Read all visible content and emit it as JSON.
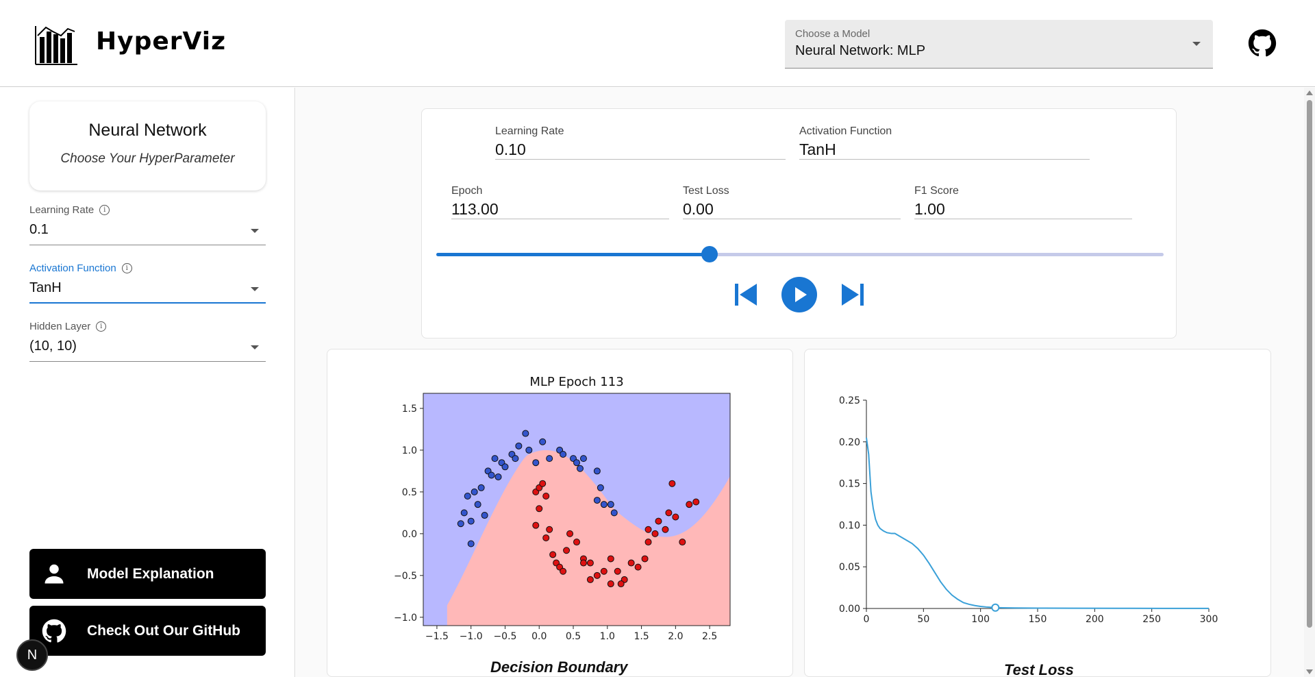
{
  "header": {
    "brand": "HyperViz",
    "model_select": {
      "label": "Choose a Model",
      "value": "Neural Network: MLP"
    }
  },
  "sidebar": {
    "card_title": "Neural Network",
    "card_subtitle": "Choose Your HyperParameter",
    "fields": [
      {
        "label": "Learning Rate",
        "value": "0.1"
      },
      {
        "label": "Activation Function",
        "value": "TanH"
      },
      {
        "label": "Hidden Layer",
        "value": "(10, 10)"
      }
    ],
    "buttons": {
      "explanation": "Model Explanation",
      "github": "Check Out Our GitHub"
    },
    "badge": "N"
  },
  "stats": {
    "learning_rate": {
      "label": "Learning Rate",
      "value": "0.10"
    },
    "activation": {
      "label": "Activation Function",
      "value": "TanH"
    },
    "epoch": {
      "label": "Epoch",
      "value": "113.00"
    },
    "test_loss": {
      "label": "Test Loss",
      "value": "0.00"
    },
    "f1": {
      "label": "F1 Score",
      "value": "1.00"
    }
  },
  "slider": {
    "value": 113,
    "max": 300,
    "fraction": 0.376
  },
  "colors": {
    "accent": "#1976d2",
    "blue_region": "#b8b8ff",
    "red_region": "#ffb8b8",
    "loss_line": "#3aa0d8"
  },
  "captions": {
    "boundary": "Decision Boundary",
    "loss": "Test Loss"
  },
  "chart_data": [
    {
      "type": "scatter",
      "title": "MLP Epoch 113",
      "xlim": [
        -1.7,
        2.8
      ],
      "ylim": [
        -1.1,
        1.68
      ],
      "xticks": [
        "−1.5",
        "−1.0",
        "−0.5",
        "0.0",
        "0.5",
        "1.0",
        "1.5",
        "2.0",
        "2.5"
      ],
      "yticks": [
        "−1.0",
        "−0.5",
        "0.0",
        "0.5",
        "1.0",
        "1.5"
      ],
      "series": [
        {
          "color": "#3355cc",
          "points": [
            [
              -1.15,
              0.12
            ],
            [
              -1.05,
              0.45
            ],
            [
              -0.95,
              0.5
            ],
            [
              -0.85,
              0.55
            ],
            [
              -1.0,
              -0.12
            ],
            [
              -0.8,
              0.22
            ],
            [
              -1.1,
              0.25
            ],
            [
              -1.0,
              0.15
            ],
            [
              -0.75,
              0.75
            ],
            [
              -0.7,
              0.7
            ],
            [
              -0.65,
              0.9
            ],
            [
              -0.55,
              0.85
            ],
            [
              -0.5,
              0.8
            ],
            [
              -0.4,
              0.95
            ],
            [
              -0.35,
              0.9
            ],
            [
              -0.3,
              1.05
            ],
            [
              -0.2,
              1.2
            ],
            [
              -0.15,
              1.0
            ],
            [
              -0.05,
              0.85
            ],
            [
              0.05,
              1.1
            ],
            [
              0.15,
              0.9
            ],
            [
              0.3,
              1.0
            ],
            [
              0.35,
              0.95
            ],
            [
              0.5,
              0.9
            ],
            [
              0.55,
              0.85
            ],
            [
              0.6,
              0.78
            ],
            [
              0.65,
              0.9
            ],
            [
              0.85,
              0.75
            ],
            [
              0.9,
              0.55
            ],
            [
              0.85,
              0.4
            ],
            [
              0.95,
              0.35
            ],
            [
              1.05,
              0.35
            ],
            [
              1.1,
              0.25
            ],
            [
              -0.6,
              0.68
            ],
            [
              -0.9,
              0.35
            ]
          ]
        },
        {
          "color": "#dd1111",
          "points": [
            [
              -0.05,
              0.5
            ],
            [
              0.0,
              0.55
            ],
            [
              0.05,
              0.6
            ],
            [
              0.1,
              0.45
            ],
            [
              0.0,
              0.3
            ],
            [
              -0.05,
              0.1
            ],
            [
              0.1,
              -0.05
            ],
            [
              0.15,
              0.05
            ],
            [
              0.2,
              -0.25
            ],
            [
              0.25,
              -0.35
            ],
            [
              0.3,
              -0.4
            ],
            [
              0.35,
              -0.45
            ],
            [
              0.45,
              0.0
            ],
            [
              0.55,
              -0.1
            ],
            [
              0.65,
              -0.3
            ],
            [
              0.75,
              -0.35
            ],
            [
              0.85,
              -0.5
            ],
            [
              0.95,
              -0.45
            ],
            [
              1.05,
              -0.3
            ],
            [
              1.15,
              -0.45
            ],
            [
              1.25,
              -0.55
            ],
            [
              1.35,
              -0.35
            ],
            [
              1.45,
              -0.4
            ],
            [
              1.55,
              -0.3
            ],
            [
              1.6,
              -0.1
            ],
            [
              1.7,
              0.0
            ],
            [
              1.75,
              0.15
            ],
            [
              1.85,
              0.05
            ],
            [
              1.9,
              0.25
            ],
            [
              1.95,
              0.6
            ],
            [
              2.0,
              0.2
            ],
            [
              2.1,
              -0.1
            ],
            [
              2.2,
              0.35
            ],
            [
              2.3,
              0.38
            ],
            [
              0.75,
              -0.55
            ],
            [
              1.05,
              -0.6
            ],
            [
              1.2,
              -0.6
            ],
            [
              0.65,
              -0.35
            ],
            [
              0.4,
              -0.2
            ],
            [
              1.6,
              0.05
            ]
          ]
        }
      ]
    },
    {
      "type": "line",
      "xlim": [
        0,
        300
      ],
      "ylim": [
        0,
        0.25
      ],
      "xticks": [
        "0",
        "50",
        "100",
        "150",
        "200",
        "250",
        "300"
      ],
      "yticks": [
        "0.00",
        "0.05",
        "0.10",
        "0.15",
        "0.20",
        "0.25"
      ],
      "x": [
        0,
        2,
        4,
        6,
        8,
        10,
        12,
        15,
        18,
        22,
        25,
        30,
        35,
        40,
        45,
        50,
        55,
        60,
        65,
        70,
        75,
        80,
        85,
        90,
        95,
        100,
        105,
        110,
        113,
        120,
        130,
        150,
        180,
        220,
        260,
        300
      ],
      "y": [
        0.205,
        0.185,
        0.14,
        0.12,
        0.107,
        0.1,
        0.096,
        0.093,
        0.091,
        0.09,
        0.09,
        0.086,
        0.082,
        0.078,
        0.072,
        0.064,
        0.054,
        0.043,
        0.032,
        0.023,
        0.016,
        0.011,
        0.007,
        0.005,
        0.0035,
        0.0025,
        0.0018,
        0.0013,
        0.001,
        0.0008,
        0.0006,
        0.0004,
        0.0003,
        0.0002,
        0.0001,
        0.0001
      ],
      "marker": {
        "x": 113,
        "y": 0.001
      }
    }
  ]
}
